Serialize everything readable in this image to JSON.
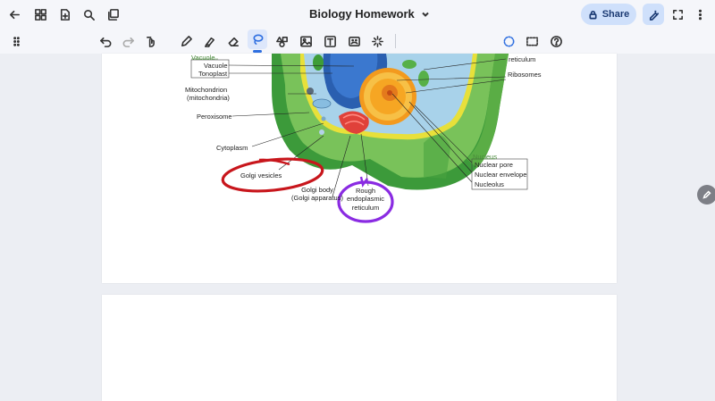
{
  "header": {
    "title": "Biology Homework",
    "share_label": "Share"
  },
  "toolbar": {
    "left_icons": [
      "back-arrow-icon",
      "grid-icon",
      "new-page-icon",
      "search-icon",
      "pages-icon"
    ],
    "tools": [
      "drag-handle-icon",
      "undo-icon",
      "redo-icon",
      "touch-tool-icon",
      "pen-icon",
      "highlighter-icon",
      "eraser-icon",
      "lasso-icon",
      "shapes-icon",
      "image-icon",
      "text-box-icon",
      "sticker-icon",
      "laser-pointer-icon"
    ],
    "right_tools": [
      "lasso-circle-icon",
      "rectangle-select-icon",
      "help-icon"
    ],
    "active_tool": "lasso-icon"
  },
  "diagram": {
    "labels": {
      "vacuole_group": "Vacuole",
      "vacuole": "Vacuole",
      "tonoplast": "Tonoplast",
      "mitochondrion_1": "Mitochondrion",
      "mitochondrion_2": "(mitochondria)",
      "peroxisome": "Peroxisome",
      "cytoplasm": "Cytoplasm",
      "golgi_vesicles": "Golgi vesicles",
      "golgi_body_1": "Golgi body",
      "golgi_body_2": "(Golgi apparatus)",
      "rough_er_1": "Rough",
      "rough_er_2": "endoplasmic",
      "rough_er_3": "reticulum",
      "reticulum_top": "reticulum",
      "ribosomes": "Ribosomes",
      "nucleus_group": "Nucleus",
      "nuclear_pore": "Nuclear pore",
      "nuclear_envelope": "Nuclear envelope",
      "nucleolus": "Nucleolus"
    },
    "annotation_colors": {
      "red_circle": "#c8161c",
      "purple_circle": "#8a2be2"
    }
  },
  "colors": {
    "accent": "#2f6fe0",
    "share_bg": "#cfe0fb",
    "cell_wall": "#3c9a3a",
    "cytoplasm": "#7cc95a",
    "nucleus": "#f39a1e",
    "vacuole": "#2a5fb0"
  }
}
